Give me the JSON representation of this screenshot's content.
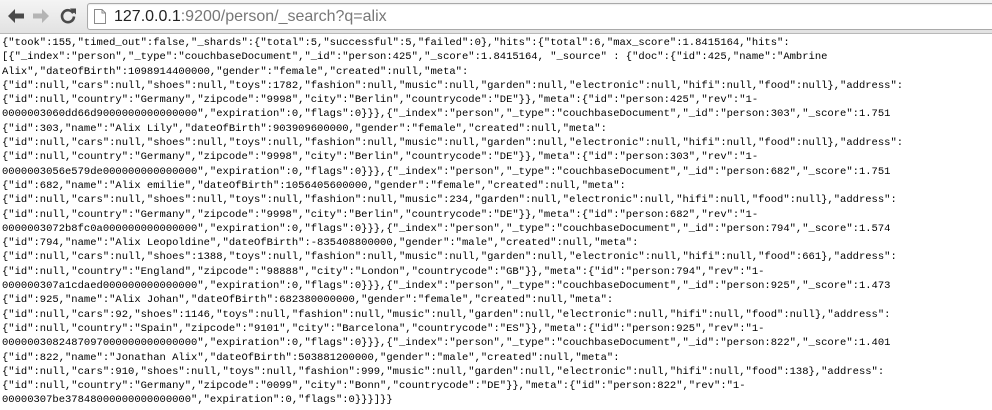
{
  "browser": {
    "address": {
      "host": "127.0.0.1",
      "rest": ":9200/person/_search?q=alix"
    },
    "icons": {
      "back": "back-arrow-icon",
      "forward": "forward-arrow-icon",
      "reload": "reload-icon",
      "page": "page-icon"
    }
  },
  "response_lines": [
    "{\"took\":155,\"timed_out\":false,\"_shards\":{\"total\":5,\"successful\":5,\"failed\":0},\"hits\":{\"total\":6,\"max_score\":1.8415164,\"hits\":",
    "[{\"_index\":\"person\",\"_type\":\"couchbaseDocument\",\"_id\":\"person:425\",\"_score\":1.8415164, \"_source\" : {\"doc\":{\"id\":425,\"name\":\"Ambrine",
    "Alix\",\"dateOfBirth\":1098914400000,\"gender\":\"female\",\"created\":null,\"meta\":",
    "{\"id\":null,\"cars\":null,\"shoes\":null,\"toys\":1782,\"fashion\":null,\"music\":null,\"garden\":null,\"electronic\":null,\"hifi\":null,\"food\":null},\"address\":",
    "{\"id\":null,\"country\":\"Germany\",\"zipcode\":\"9998\",\"city\":\"Berlin\",\"countrycode\":\"DE\"}},\"meta\":{\"id\":\"person:425\",\"rev\":\"1-",
    "0000003060dd66d9000000000000000\",\"expiration\":0,\"flags\":0}}},{\"_index\":\"person\",\"_type\":\"couchbaseDocument\",\"_id\":\"person:303\",\"_score\":1.751",
    "{\"id\":303,\"name\":\"Alix Lily\",\"dateOfBirth\":903909600000,\"gender\":\"female\",\"created\":null,\"meta\":",
    "{\"id\":null,\"cars\":null,\"shoes\":null,\"toys\":null,\"fashion\":null,\"music\":null,\"garden\":null,\"electronic\":null,\"hifi\":null,\"food\":null},\"address\":",
    "{\"id\":null,\"country\":\"Germany\",\"zipcode\":\"9998\",\"city\":\"Berlin\",\"countrycode\":\"DE\"}},\"meta\":{\"id\":\"person:303\",\"rev\":\"1-",
    "0000003056e579de000000000000000\",\"expiration\":0,\"flags\":0}}},{\"_index\":\"person\",\"_type\":\"couchbaseDocument\",\"_id\":\"person:682\",\"_score\":1.751",
    "{\"id\":682,\"name\":\"Alix emilie\",\"dateOfBirth\":1056405600000,\"gender\":\"female\",\"created\":null,\"meta\":",
    "{\"id\":null,\"cars\":null,\"shoes\":null,\"toys\":null,\"fashion\":null,\"music\":234,\"garden\":null,\"electronic\":null,\"hifi\":null,\"food\":null},\"address\":",
    "{\"id\":null,\"country\":\"Germany\",\"zipcode\":\"9998\",\"city\":\"Berlin\",\"countrycode\":\"DE\"}},\"meta\":{\"id\":\"person:682\",\"rev\":\"1-",
    "0000003072b8fc0a000000000000000\",\"expiration\":0,\"flags\":0}}},{\"_index\":\"person\",\"_type\":\"couchbaseDocument\",\"_id\":\"person:794\",\"_score\":1.574",
    "{\"id\":794,\"name\":\"Alix Leopoldine\",\"dateOfBirth\":-835408800000,\"gender\":\"male\",\"created\":null,\"meta\":",
    "{\"id\":null,\"cars\":null,\"shoes\":1388,\"toys\":null,\"fashion\":null,\"music\":null,\"garden\":null,\"electronic\":null,\"hifi\":null,\"food\":661},\"address\":",
    "{\"id\":null,\"country\":\"England\",\"zipcode\":\"98888\",\"city\":\"London\",\"countrycode\":\"GB\"}},\"meta\":{\"id\":\"person:794\",\"rev\":\"1-",
    "000000307a1cdaed000000000000000\",\"expiration\":0,\"flags\":0}}},{\"_index\":\"person\",\"_type\":\"couchbaseDocument\",\"_id\":\"person:925\",\"_score\":1.473",
    "{\"id\":925,\"name\":\"Alix Johan\",\"dateOfBirth\":682380000000,\"gender\":\"female\",\"created\":null,\"meta\":",
    "{\"id\":null,\"cars\":92,\"shoes\":1146,\"toys\":null,\"fashion\":null,\"music\":null,\"garden\":null,\"electronic\":null,\"hifi\":null,\"food\":null},\"address\":",
    "{\"id\":null,\"country\":\"Spain\",\"zipcode\":\"9101\",\"city\":\"Barcelona\",\"countrycode\":\"ES\"}},\"meta\":{\"id\":\"person:925\",\"rev\":\"1-",
    "0000003082487097000000000000000\",\"expiration\":0,\"flags\":0}}},{\"_index\":\"person\",\"_type\":\"couchbaseDocument\",\"_id\":\"person:822\",\"_score\":1.401",
    "{\"id\":822,\"name\":\"Jonathan Alix\",\"dateOfBirth\":503881200000,\"gender\":\"male\",\"created\":null,\"meta\":",
    "{\"id\":null,\"cars\":910,\"shoes\":null,\"toys\":null,\"fashion\":999,\"music\":null,\"garden\":null,\"electronic\":null,\"hifi\":null,\"food\":138},\"address\":",
    "{\"id\":null,\"country\":\"Germany\",\"zipcode\":\"0099\",\"city\":\"Bonn\",\"countrycode\":\"DE\"}},\"meta\":{\"id\":\"person:822\",\"rev\":\"1-",
    "00000307be37848000000000000000\",\"expiration\":0,\"flags\":0}}}]}}"
  ]
}
